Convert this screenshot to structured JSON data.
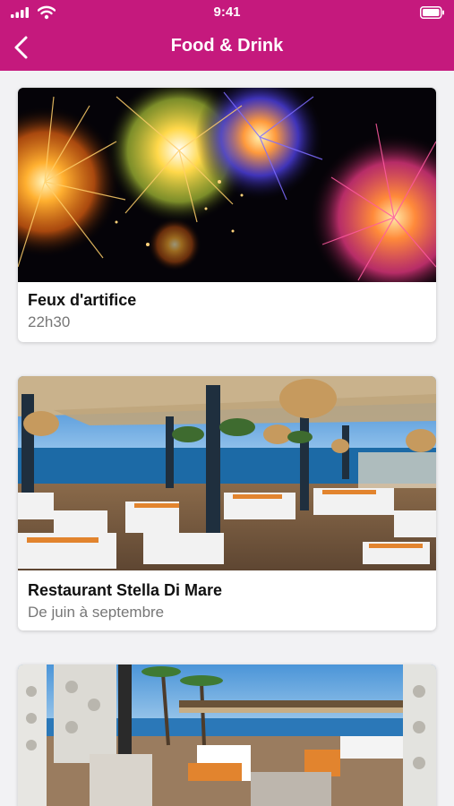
{
  "status_bar": {
    "time": "9:41"
  },
  "nav": {
    "title": "Food & Drink"
  },
  "items": [
    {
      "title": "Feux d'artifice",
      "subtitle": "22h30"
    },
    {
      "title": "Restaurant Stella Di Mare",
      "subtitle": "De juin à septembre"
    },
    {
      "title": "",
      "subtitle": ""
    }
  ],
  "colors": {
    "header": "#c5197d",
    "background": "#f2f2f4"
  },
  "icons": [
    "signal-icon",
    "wifi-icon",
    "battery-icon",
    "back-chevron-icon"
  ]
}
